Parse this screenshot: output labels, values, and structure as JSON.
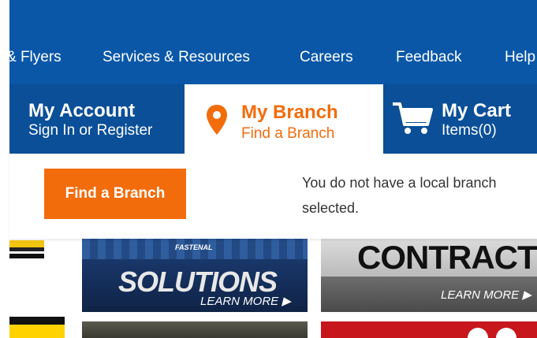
{
  "top_nav": {
    "items": [
      "& Flyers",
      "Services & Resources",
      "Careers",
      "Feedback",
      "Help"
    ]
  },
  "account": {
    "title": "My Account",
    "subtitle": "Sign In or Register"
  },
  "branch": {
    "title": "My Branch",
    "subtitle": "Find a Branch"
  },
  "cart": {
    "title": "My Cart",
    "subtitle": "Items(0)"
  },
  "dropdown": {
    "button_label": "Find a Branch",
    "message": "You do not have a local branch selected."
  },
  "tiles": {
    "solutions": {
      "brand": "FASTENAL",
      "title": "SOLUTIONS",
      "cta": "LEARN MORE ▶"
    },
    "contracts": {
      "title": "CONTRACTS",
      "cta": "LEARN MORE ▶"
    }
  },
  "colors": {
    "nav_blue": "#0a57a8",
    "account_blue": "#0a4f98",
    "accent_orange": "#f26c0c"
  },
  "icons": [
    "location-pin-icon",
    "shopping-cart-icon",
    "play-arrow-icon"
  ]
}
